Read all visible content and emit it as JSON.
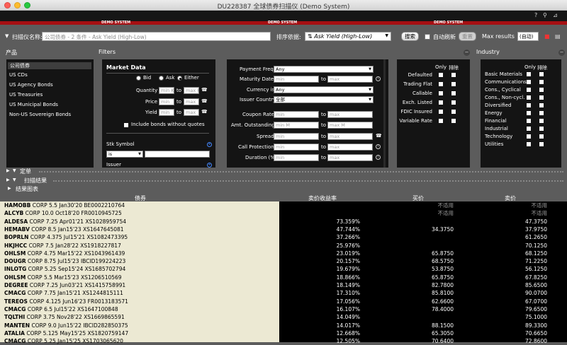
{
  "window": {
    "title": "DU228387 全球债券扫描仪 (Demo System)"
  },
  "demo_label": "DEMO SYSTEM",
  "toolbar": {
    "scanner_name_label": "扫描仪名称:",
    "scanner_name_value": "公司债券 - 2 条件 - Ask Yield (High-Low)",
    "sort_label": "排序依据:",
    "sort_value": "Ask Yield (High-Low)",
    "search_button": "搜索",
    "auto_refresh_label": "自动刷新",
    "reset_button": "重置",
    "max_results_label": "Max results",
    "max_results_value": "(自动)"
  },
  "headers": {
    "product": "产品",
    "filters": "Filters",
    "industry": "Industry"
  },
  "products": [
    "公司债券",
    "US CDs",
    "US Agency Bonds",
    "US Treasuries",
    "US Municipal Bonds",
    "Non-US Sovereign Bonds"
  ],
  "market_data": {
    "title": "Market Data",
    "bid": "Bid",
    "ask": "Ask",
    "either": "Either",
    "quantity": "Quantity",
    "price": "Price",
    "yield": "Yield",
    "min": "min",
    "max": "max",
    "min_k": "min K",
    "max_k": "max K",
    "to": "to",
    "include_no_quotes": "Include bonds without quotes",
    "stk_symbol": "Stk Symbol",
    "stk_op": "is",
    "issuer": "Issuer"
  },
  "filters_mid": {
    "payment_freq": "Payment Freq.",
    "payment_freq_value": "Any",
    "maturity_date": "Maturity Date",
    "currency": "Currency is",
    "currency_value": "Any",
    "issuer_country": "Issuer Country",
    "issuer_country_value": "全部",
    "coupon_rate": "Coupon Rate",
    "amt_outstanding": "Amt. Outstanding",
    "min_m": "min M",
    "max_m": "max M",
    "spread": "Spread",
    "call_protection": "Call Protection",
    "duration": "Duration (%)"
  },
  "flags": {
    "only": "Only",
    "exclude": "排除",
    "items": [
      "Defaulted",
      "Trading Flat",
      "Callable",
      "Exch. Listed",
      "FDIC Insured",
      "Variable Rate"
    ]
  },
  "industry": {
    "only": "Only",
    "exclude": "排除",
    "items": [
      "Basic Materials",
      "Communications",
      "Cons., Cyclical",
      "Cons., Non-cycl.",
      "Diversified",
      "Energy",
      "Financial",
      "Industrial",
      "Technology",
      "Utilities"
    ]
  },
  "sections": {
    "order": "定单",
    "results": "扫描结果",
    "chart": "结果图表"
  },
  "columns": {
    "bond": "债券",
    "ask_yield": "卖价收益率",
    "bid": "买价",
    "ask": "卖价"
  },
  "not_applicable": "不适用",
  "rows": [
    {
      "ticker": "HAMOBB",
      "desc": "CORP 5.5 Jan30'20 BE0002210764",
      "yield": "",
      "bid": "不适用",
      "ask": "不适用"
    },
    {
      "ticker": "ALCYB",
      "desc": "CORP 10.0 Oct18'20 FR0010945725",
      "yield": "",
      "bid": "不适用",
      "ask": "不适用"
    },
    {
      "ticker": "ALDESA",
      "desc": "CORP 7.25 Apr01'21 XS1028959754",
      "yield": "73.359%",
      "bid": "",
      "ask": "47.3750"
    },
    {
      "ticker": "HEMABV",
      "desc": "CORP 8.5 Jan15'23 XS1647645081",
      "yield": "47.744%",
      "bid": "34.3750",
      "ask": "37.9750"
    },
    {
      "ticker": "BOPRLN",
      "desc": "CORP 4.375 Jul15'21 XS1082473395",
      "yield": "37.266%",
      "bid": "",
      "ask": "61.2650"
    },
    {
      "ticker": "HKJHCC",
      "desc": "CORP 7.5 Jan28'22 XS1918227817",
      "yield": "25.976%",
      "bid": "",
      "ask": "70.1250"
    },
    {
      "ticker": "OHLSM",
      "desc": "CORP 4.75 Mar15'22 XS1043961439",
      "yield": "23.019%",
      "bid": "65.8750",
      "ask": "68.1250"
    },
    {
      "ticker": "DOUGR",
      "desc": "CORP 8.75 Jul15'23 IBCID199224223",
      "yield": "20.157%",
      "bid": "68.5750",
      "ask": "71.2250"
    },
    {
      "ticker": "INLOTG",
      "desc": "CORP 5.25 Sep15'24 XS1685702794",
      "yield": "19.679%",
      "bid": "53.8750",
      "ask": "56.1250"
    },
    {
      "ticker": "OHLSM",
      "desc": "CORP 5.5 Mar15'23 XS1206510569",
      "yield": "18.866%",
      "bid": "65.8750",
      "ask": "67.8250"
    },
    {
      "ticker": "DEGREE",
      "desc": "CORP 7.25 Jun03'21 XS1415758991",
      "yield": "18.149%",
      "bid": "82.7800",
      "ask": "85.6500"
    },
    {
      "ticker": "CMACG",
      "desc": "CORP 7.75 Jan15'21 XS1244815111",
      "yield": "17.310%",
      "bid": "85.8100",
      "ask": "90.0700"
    },
    {
      "ticker": "TEREOS",
      "desc": "CORP 4.125 Jun16'23 FR0013183571",
      "yield": "17.056%",
      "bid": "62.6600",
      "ask": "67.0700"
    },
    {
      "ticker": "CMACG",
      "desc": "CORP 6.5 Jul15'22 XS1647100848",
      "yield": "16.107%",
      "bid": "78.4000",
      "ask": "79.6500"
    },
    {
      "ticker": "TQLTHI",
      "desc": "CORP 3.75 Nov28'22 XS1669865591",
      "yield": "14.049%",
      "bid": "",
      "ask": "75.1000"
    },
    {
      "ticker": "MANTEN",
      "desc": "CORP 9.0 Jun15'22 IBCID282850375",
      "yield": "14.017%",
      "bid": "88.1500",
      "ask": "89.3300"
    },
    {
      "ticker": "ATALIA",
      "desc": "CORP 5.125 May15'25 XS1820759147",
      "yield": "12.668%",
      "bid": "65.3050",
      "ask": "70.6650"
    },
    {
      "ticker": "CMACG",
      "desc": "CORP 5.25 Jan15'25 XS1703065620",
      "yield": "12.505%",
      "bid": "70.6400",
      "ask": "72.8600"
    }
  ]
}
